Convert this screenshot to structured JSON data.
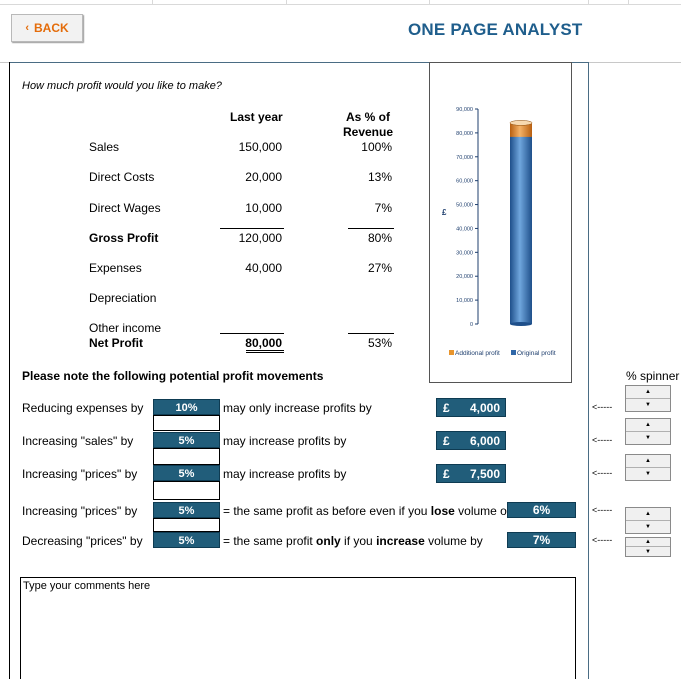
{
  "header": {
    "back_label": "BACK",
    "title": "ONE PAGE ANALYST"
  },
  "question": "How much profit would you like to make?",
  "table": {
    "col_last_year": "Last year",
    "col_pct_line1": "As % of",
    "col_pct_line2": "Revenue",
    "rows": [
      {
        "label": "Sales",
        "value": "150,000",
        "pct": "100%"
      },
      {
        "label": "Direct Costs",
        "value": "20,000",
        "pct": "13%"
      },
      {
        "label": "Direct Wages",
        "value": "10,000",
        "pct": "7%"
      },
      {
        "label": "Gross Profit",
        "value": "120,000",
        "pct": "80%"
      },
      {
        "label": "Expenses",
        "value": "40,000",
        "pct": "27%"
      },
      {
        "label": "Depreciation",
        "value": "",
        "pct": ""
      },
      {
        "label": "Other income",
        "value": "",
        "pct": ""
      },
      {
        "label": "Net Profit",
        "value": "80,000",
        "pct": "53%"
      }
    ]
  },
  "chart_data": {
    "type": "bar",
    "categories": [
      ""
    ],
    "series": [
      {
        "name": "Additional profit",
        "values": [
          0
        ]
      },
      {
        "name": "Original profit",
        "values": [
          80000
        ]
      }
    ],
    "ylabel": "£",
    "ylim": [
      0,
      90000
    ],
    "yticks": [
      "0",
      "10,000",
      "20,000",
      "30,000",
      "40,000",
      "50,000",
      "60,000",
      "70,000",
      "80,000",
      "90,000"
    ],
    "legend": "bottom",
    "colors": {
      "additional": "#e8952d",
      "original": "#2f67a8"
    }
  },
  "movements": {
    "heading": "Please note the following potential profit movements",
    "spinner_heading": "% spinner",
    "arrow": "<-----",
    "currency": "£",
    "rows": [
      {
        "label": "Reducing expenses by",
        "input": "10%",
        "mid": "may only increase profits by",
        "result": "4,000",
        "is_currency": true
      },
      {
        "label": "Increasing \"sales\" by",
        "input": "5%",
        "mid": "may increase profits by",
        "result": "6,000",
        "is_currency": true
      },
      {
        "label": "Increasing \"prices\" by",
        "input": "5%",
        "mid": "may increase profits by",
        "result": "7,500",
        "is_currency": true
      },
      {
        "label": "Increasing \"prices\" by",
        "input": "5%",
        "mid_pre": "= the same profit as before even if you ",
        "mid_b1": "lose",
        "mid_post": " volume of",
        "result": "6%",
        "is_currency": false
      },
      {
        "label": "Decreasing \"prices\" by",
        "input": "5%",
        "mid_pre": "= the same profit ",
        "mid_b1": "only",
        "mid_mid": " if you ",
        "mid_b2": "increase",
        "mid_post": " volume by",
        "result": "7%",
        "is_currency": false
      }
    ],
    "spinner_up": "▲",
    "spinner_down": "▼"
  },
  "comments": {
    "placeholder": "Type your comments here"
  }
}
